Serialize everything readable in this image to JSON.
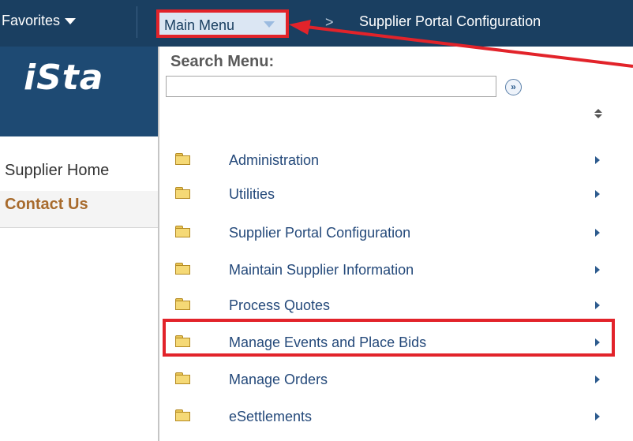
{
  "topbar": {
    "favorites_label": "Favorites",
    "main_menu_label": "Main Menu",
    "breadcrumb_separator": ">",
    "current_page": "Supplier Portal Configuration"
  },
  "banner": {
    "logo_text": "iSta"
  },
  "left_nav": {
    "home_label": "Supplier Home",
    "contact_label": "Contact Us"
  },
  "menu": {
    "search_title": "Search Menu:",
    "search_value": "",
    "go_icon": "double-chevron-right-icon",
    "sort_icon": "sort-icon",
    "items": [
      {
        "label": "Administration"
      },
      {
        "label": "Utilities"
      },
      {
        "label": "Supplier Portal Configuration"
      },
      {
        "label": "Maintain Supplier Information"
      },
      {
        "label": "Process Quotes"
      },
      {
        "label": "Manage Events and Place Bids"
      },
      {
        "label": "Manage Orders"
      },
      {
        "label": "eSettlements"
      }
    ]
  },
  "annotation": {
    "highlighted_item": "Manage Events and Place Bids",
    "color": "#e2232a"
  },
  "colors": {
    "nav_bar": "#1a3f61",
    "banner": "#1e4a73",
    "link": "#24497a",
    "highlight": "#e2232a",
    "contact": "#a86b2d"
  }
}
